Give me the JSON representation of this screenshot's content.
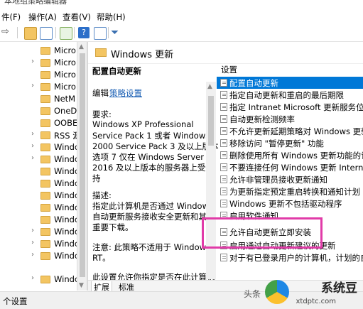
{
  "window": {
    "title": "本地组策略编辑器"
  },
  "menu": [
    "件(F)",
    "操作(A)",
    "查看(V)",
    "帮助(H)"
  ],
  "toolbar": {
    "icons": [
      "forward-arrow-icon",
      "folder-up-icon",
      "show-hide-tree-icon",
      "export-icon",
      "help-icon",
      "properties-icon",
      "filter-icon"
    ]
  },
  "tree": {
    "items": [
      "Micro",
      "Micro",
      "Micro",
      "Micro",
      "NetM",
      "OneDi",
      "OOBE",
      "RSS 源",
      "Windc",
      "Windc",
      "Windc",
      "Windc",
      "Windc",
      "Windc",
      "Windc",
      "Windc",
      "Windc",
      "Windc",
      "Windc"
    ]
  },
  "extended": {
    "title": "Windows 更新",
    "policy_name": "配置自动更新",
    "edit_prefix": "编辑",
    "edit_link": "策略设置",
    "requirements_label": "要求:",
    "requirements_lines": [
      "Windows XP Professional",
      "Service Pack 1 或者 Windows",
      "2000 Service Pack 3 及以上版本",
      "选项 7 仅在 Windows Server",
      "2016 及以上版本的服务器上受支",
      "持"
    ],
    "description_label": "描述:",
    "description_lines": [
      "指定此计算机是否通过 Windows",
      "自动更新服务接收安全更新和其他",
      "重要下载。"
    ],
    "note_lines": [
      "注意: 此策略不适用于 Windows",
      "RT。"
    ],
    "more_line": "此设置允许你指定是否在此计算机"
  },
  "settings": {
    "header": "设置",
    "rows": [
      "配置自动更新",
      "指定自动更新和重启的最后期限",
      "指定 Intranet Microsoft 更新服务位置",
      "自动更新检测频率",
      "不允许更新延期策略对 Windows 更新执行",
      "移除访问 \"暂停更新\" 功能",
      "删除使用所有 Windows 更新功能的访问权",
      "不要连接任何 Windows 更新 Internet 位",
      "允许非管理员接收更新通知",
      "为更新指定预定重启转换和通知计划",
      "Windows 更新不包括驱动程序",
      "启用软件通知",
      "允许自动更新立即安装",
      "启用通过自动更新建议的更新",
      "对于有已登录用户的计算机，计划的自动更"
    ],
    "selected_index": 0,
    "selected_bg": "#0078d7"
  },
  "highlight_color": "#e13ba8",
  "tabs": [
    "扩展",
    "标准"
  ],
  "status": {
    "text": "个设置"
  },
  "watermark": {
    "prefix": "头条",
    "brand": "系统豆",
    "url": "xtdptc.com"
  }
}
